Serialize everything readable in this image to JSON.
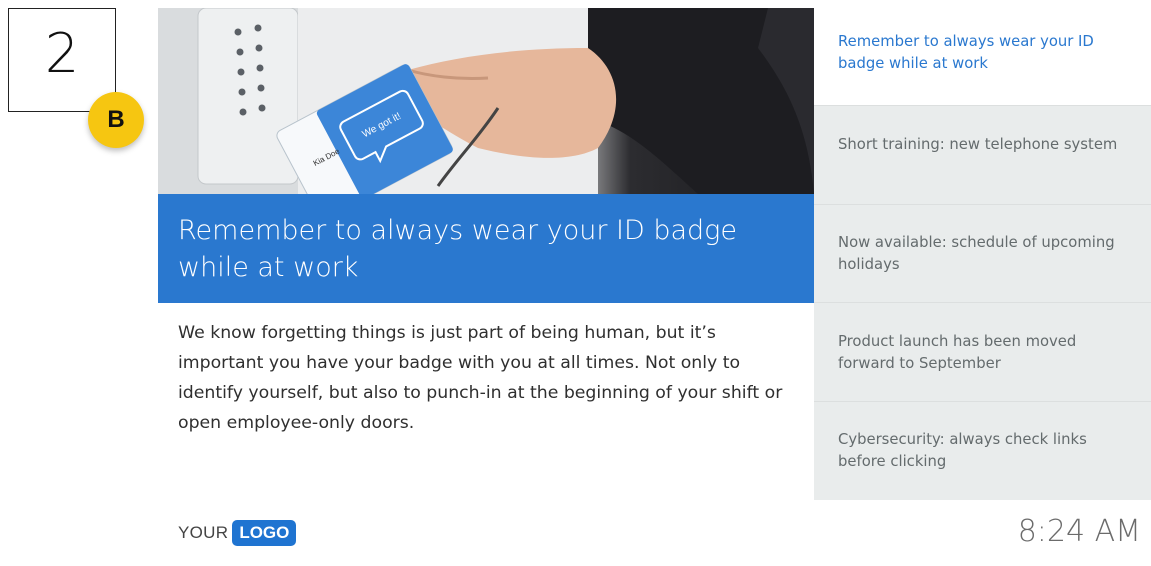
{
  "step": {
    "number": "2",
    "variant": "B"
  },
  "featured": {
    "headline": "Remember to always wear your ID badge while at work",
    "body": "We know forgetting things is just part of being human, but it’s important you have your badge with you at all times. Not only to identify yourself, but also to punch-in at the beginning of your shift or open employee-only doors.",
    "image": {
      "badge_text": "We got it!",
      "card_name": "Kia Doe"
    }
  },
  "sidebar": {
    "items": [
      {
        "label": "Remember to always wear your ID badge while at work",
        "active": true
      },
      {
        "label": "Short training: new telephone system",
        "active": false
      },
      {
        "label": "Now available: schedule of upcoming holidays",
        "active": false
      },
      {
        "label": "Product launch has been moved forward to September",
        "active": false
      },
      {
        "label": "Cybersecurity: always check links before clicking",
        "active": false
      }
    ]
  },
  "footer": {
    "logo_text": "YOUR",
    "logo_mark": "LOGO",
    "time": "8:24 AM"
  },
  "colors": {
    "accent": "#2a78cf",
    "badge_yellow": "#f6c611",
    "sidebar_bg": "#e9ecec"
  }
}
